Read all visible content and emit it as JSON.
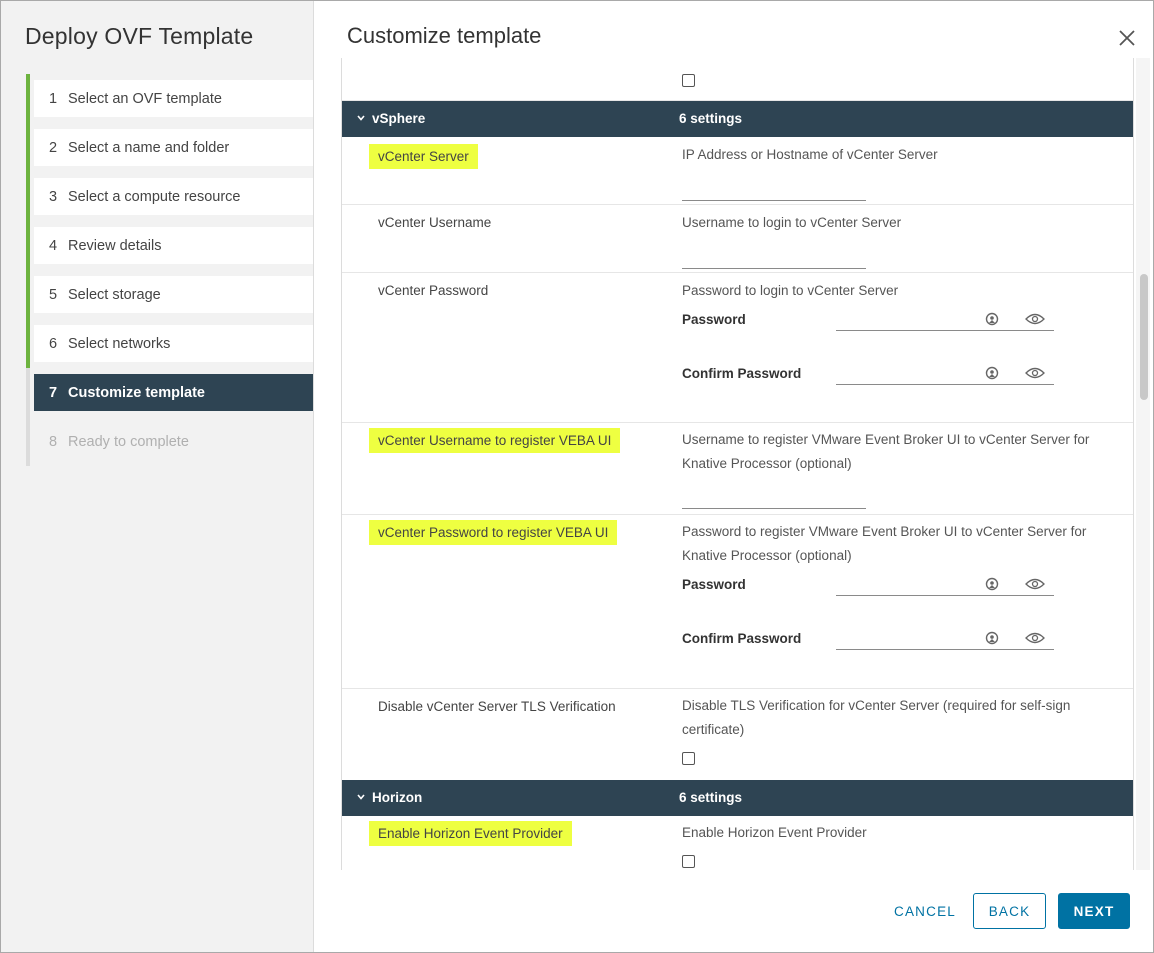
{
  "sidebar": {
    "title": "Deploy OVF Template",
    "steps": [
      {
        "num": "1",
        "label": "Select an OVF template"
      },
      {
        "num": "2",
        "label": "Select a name and folder"
      },
      {
        "num": "3",
        "label": "Select a compute resource"
      },
      {
        "num": "4",
        "label": "Review details"
      },
      {
        "num": "5",
        "label": "Select storage"
      },
      {
        "num": "6",
        "label": "Select networks"
      },
      {
        "num": "7",
        "label": "Customize template"
      },
      {
        "num": "8",
        "label": "Ready to complete"
      }
    ]
  },
  "main": {
    "title": "Customize template"
  },
  "sections": {
    "vsphere": {
      "name": "vSphere",
      "count": "6 settings"
    },
    "horizon": {
      "name": "Horizon",
      "count": "6 settings"
    }
  },
  "fields": {
    "vcenter_server": {
      "label": "vCenter Server",
      "desc": "IP Address or Hostname of vCenter Server"
    },
    "vcenter_username": {
      "label": "vCenter Username",
      "desc": "Username to login to vCenter Server"
    },
    "vcenter_password": {
      "label": "vCenter Password",
      "desc": "Password to login to vCenter Server"
    },
    "veba_username": {
      "label": "vCenter Username to register VEBA UI",
      "desc": "Username to register VMware Event Broker UI to vCenter Server for Knative Processor (optional)"
    },
    "veba_password": {
      "label": "vCenter Password to register VEBA UI",
      "desc": "Password to register VMware Event Broker UI to vCenter Server for Knative Processor (optional)"
    },
    "disable_tls": {
      "label": "Disable vCenter Server TLS Verification",
      "desc": "Disable TLS Verification for vCenter Server (required for self-sign certificate)"
    },
    "horizon_enable": {
      "label": "Enable Horizon Event Provider",
      "desc": "Enable Horizon Event Provider"
    }
  },
  "password_labels": {
    "password": "Password",
    "confirm": "Confirm Password"
  },
  "footer": {
    "cancel": "CANCEL",
    "back": "BACK",
    "next": "NEXT"
  },
  "colors": {
    "accent": "#0072a3",
    "header": "#2e4453",
    "highlight": "#eeff41",
    "progress": "#6db33f"
  }
}
